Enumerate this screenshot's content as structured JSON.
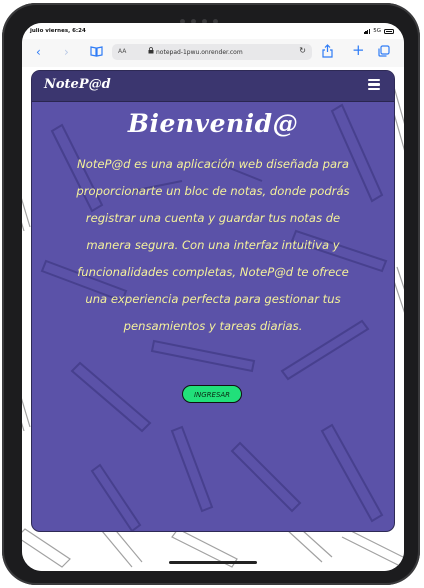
{
  "status_bar": {
    "time": "julio viernes, 6:24",
    "network": "5G"
  },
  "browser": {
    "text_size_label": "AA",
    "url": "notepad-1pwu.onrender.com",
    "icons": {
      "back": "chevron-left-icon",
      "forward": "chevron-right-icon",
      "bookmarks": "book-icon",
      "lock": "lock-icon",
      "reload": "reload-icon",
      "share": "share-icon",
      "new_tab": "plus-icon",
      "tabs": "tabs-icon"
    }
  },
  "navbar": {
    "brand": "NoteP@d",
    "menu_icon": "hamburger-menu-icon"
  },
  "hero": {
    "title": "Bienvenid@",
    "description": "NoteP@d es una aplicación web diseñada para proporcionarte un bloc de notas, donde podrás registrar una cuenta y guardar tus notas de manera segura. Con una interfaz intuitiva y funcionalidades completas, NoteP@d te ofrece una experiencia perfecta para gestionar tus pensamientos y tareas diarias.",
    "button": "INGRESAR"
  },
  "colors": {
    "card_bg": "#5b52a8",
    "navbar_bg": "#3b366f",
    "description_text": "#f4f19c",
    "button_bg": "#21e07a",
    "browser_accent": "#2f7cf6"
  }
}
